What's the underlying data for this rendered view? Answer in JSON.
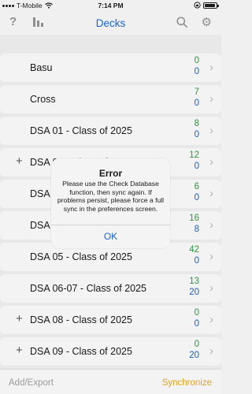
{
  "status_bar": {
    "carrier": "T-Mobile",
    "time": "7:14 PM",
    "battery_level": 0.95
  },
  "nav": {
    "title": "Decks",
    "help_glyph": "?",
    "left_icons": [
      "help-icon",
      "stats-icon"
    ],
    "right_icons": [
      "search-icon",
      "gear-icon"
    ]
  },
  "decks": [
    {
      "name": "Basu",
      "due": "0",
      "new": "0",
      "expandable": false
    },
    {
      "name": "Cross",
      "due": "7",
      "new": "0",
      "expandable": false
    },
    {
      "name": "DSA 01 - Class of 2025",
      "due": "8",
      "new": "0",
      "expandable": false
    },
    {
      "name": "DSA 02 - Class of 2025",
      "due": "12",
      "new": "0",
      "expandable": true
    },
    {
      "name": "DSA 03 - Class of 2025",
      "due": "6",
      "new": "0",
      "expandable": false
    },
    {
      "name": "DSA 04 - Class of 2025",
      "due": "16",
      "new": "8",
      "expandable": false
    },
    {
      "name": "DSA 05 - Class of 2025",
      "due": "42",
      "new": "0",
      "expandable": false
    },
    {
      "name": "DSA 06-07 - Class of 2025",
      "due": "13",
      "new": "20",
      "expandable": false
    },
    {
      "name": "DSA 08 - Class of 2025",
      "due": "0",
      "new": "0",
      "expandable": true
    },
    {
      "name": "DSA 09 - Class of 2025",
      "due": "0",
      "new": "20",
      "expandable": true
    }
  ],
  "dialog": {
    "title": "Error",
    "message": "Please use the Check Database function, then sync again. If problems persist, please force a full sync in the preferences screen.",
    "ok_label": "OK"
  },
  "toolbar": {
    "add_export_label": "Add/Export",
    "sync_label": "Synchronize"
  },
  "colors": {
    "accent_blue": "#1565d8",
    "due_green": "#2a9d3c",
    "sync_orange": "#e3a221"
  }
}
